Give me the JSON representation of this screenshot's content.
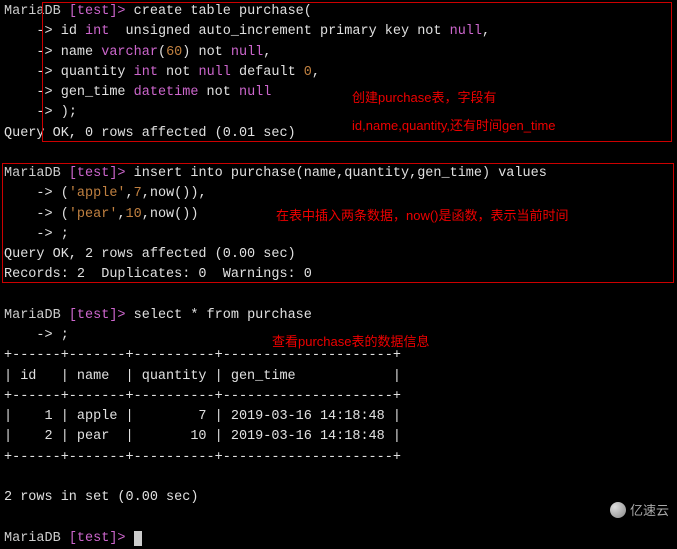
{
  "prompt": {
    "db": "MariaDB",
    "path": "[test]>"
  },
  "block1": {
    "l1": " create table purchase(",
    "l2a": "id ",
    "l2b": "int",
    "l2c": "  unsigned auto_increment primary key not ",
    "l2d": "null",
    "l2e": ",",
    "l3a": "name ",
    "l3b": "varchar",
    "l3c": "(",
    "l3d": "60",
    "l3e": ") not ",
    "l3f": "null",
    "l3g": ",",
    "l4a": "quantity ",
    "l4b": "int",
    "l4c": " not ",
    "l4d": "null",
    "l4e": " default ",
    "l4f": "0",
    "l4g": ",",
    "l5a": "gen_time ",
    "l5b": "datetime",
    "l5c": " not ",
    "l5d": "null",
    "l6": ");",
    "result": "Query OK, 0 rows affected (0.01 sec)"
  },
  "cont": "    -> ",
  "block2": {
    "l1": " insert into purchase(name,quantity,gen_time) values",
    "l2a": "(",
    "l2b": "'apple'",
    "l2c": ",",
    "l2d": "7",
    "l2e": ",now()),",
    "l3a": "(",
    "l3b": "'pear'",
    "l3c": ",",
    "l3d": "10",
    "l3e": ",now())",
    "l4": ";",
    "r1": "Query OK, 2 rows affected (0.00 sec)",
    "r2": "Records: 2  Duplicates: 0  Warnings: 0"
  },
  "block3": {
    "l1": " select * from purchase",
    "l2": ";",
    "rule": "+------+-------+----------+---------------------+",
    "hdr": "| id   | name  | quantity | gen_time            |",
    "row1": "|    1 | apple |        7 | 2019-03-16 14:18:48 |",
    "row2": "|    2 | pear  |       10 | 2019-03-16 14:18:48 |",
    "foot": "2 rows in set (0.00 sec)"
  },
  "anno": {
    "a1": "创建purchase表，字段有",
    "a2": "id,name,quantity,还有时间gen_time",
    "b1": "在表中插入两条数据，now()是函数，表示当前时间",
    "c1": "查看purchase表的数据信息"
  },
  "watermark": "亿速云",
  "chart_data": {
    "type": "table",
    "title": "purchase",
    "columns": [
      "id",
      "name",
      "quantity",
      "gen_time"
    ],
    "rows": [
      [
        1,
        "apple",
        7,
        "2019-03-16 14:18:48"
      ],
      [
        2,
        "pear",
        10,
        "2019-03-16 14:18:48"
      ]
    ]
  }
}
